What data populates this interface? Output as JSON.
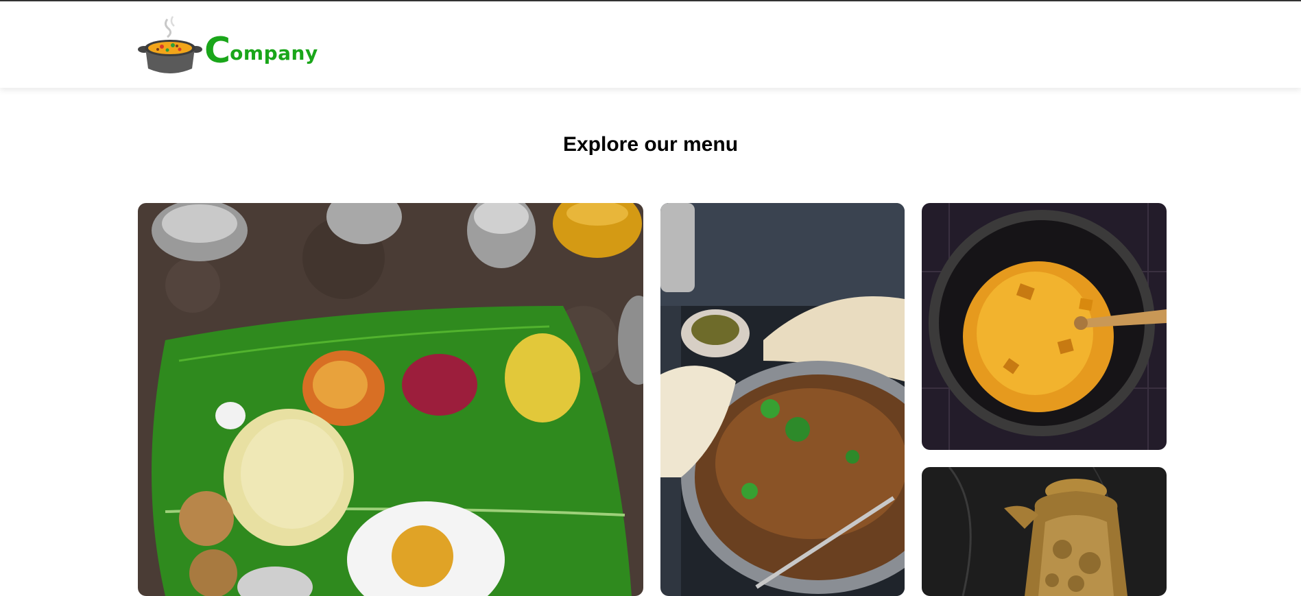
{
  "header": {
    "logo": {
      "letter": "C",
      "rest": "ompany",
      "icon": "cooking-pot-logo-icon"
    }
  },
  "main": {
    "title": "Explore our menu",
    "tiles": [
      {
        "icon": "thali-banana-leaf-image"
      },
      {
        "icon": "keema-pan-naan-image"
      },
      {
        "icon": "pumpkin-stir-fry-pot-image"
      },
      {
        "icon": "brass-jug-image"
      }
    ]
  },
  "colors": {
    "brand_green": "#1aa61a",
    "topline": "#333333"
  }
}
